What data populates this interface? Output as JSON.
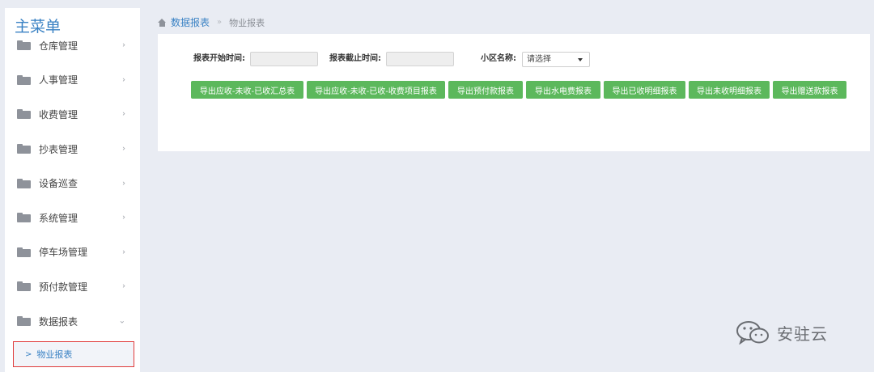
{
  "sidebar": {
    "title": "主菜单",
    "items": [
      {
        "label": "仓库管理",
        "icon": "folder-icon",
        "chevron": "›"
      },
      {
        "label": "人事管理",
        "icon": "folder-icon",
        "chevron": "›"
      },
      {
        "label": "收费管理",
        "icon": "folder-icon",
        "chevron": "›"
      },
      {
        "label": "抄表管理",
        "icon": "folder-icon",
        "chevron": "›"
      },
      {
        "label": "设备巡查",
        "icon": "folder-icon",
        "chevron": "›"
      },
      {
        "label": "系统管理",
        "icon": "folder-icon",
        "chevron": "›"
      },
      {
        "label": "停车场管理",
        "icon": "folder-icon",
        "chevron": "›"
      },
      {
        "label": "预付款管理",
        "icon": "folder-icon",
        "chevron": "›"
      },
      {
        "label": "数据报表",
        "icon": "folder-icon",
        "chevron": "⌄"
      }
    ],
    "submenu": {
      "label": "物业报表",
      "chevron": ">"
    }
  },
  "breadcrumb": {
    "icon": "home-icon",
    "parent": "数据报表",
    "separator": "»",
    "current": "物业报表"
  },
  "filters": {
    "start_label": "报表开始时间:",
    "start_value": "",
    "end_label": "报表截止时间:",
    "end_value": "",
    "community_label": "小区名称:",
    "community_selected": "请选择"
  },
  "buttons": [
    "导出应收-未收-已收汇总表",
    "导出应收-未收-已收-收费项目报表",
    "导出预付款报表",
    "导出水电费报表",
    "导出已收明细报表",
    "导出未收明细报表",
    "导出赠送款报表"
  ],
  "watermark": {
    "text": "安驻云",
    "icon": "wechat-icon"
  },
  "colors": {
    "accent": "#3a82c4",
    "button_green": "#5cb85c",
    "highlight_border": "#e03b3b",
    "background": "#e9ecf3"
  }
}
